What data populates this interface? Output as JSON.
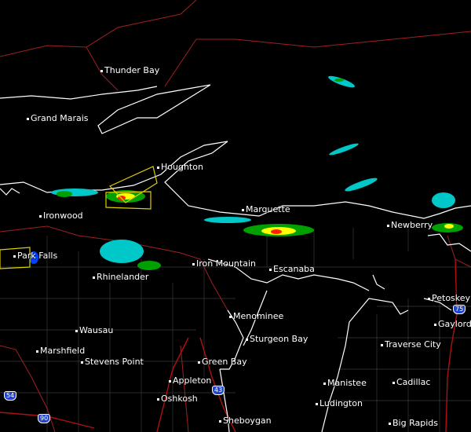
{
  "map": {
    "background": "#000000",
    "colors": {
      "land_boundary": "#a02020",
      "county_line": "#444444",
      "shoreline": "#ffffff",
      "interstate": "#b01010",
      "warning_polygon": "#e0d000",
      "radar_light": "#00c8c8",
      "radar_medium": "#00a000",
      "radar_strong": "#ffff00",
      "radar_severe": "#ff2000"
    },
    "cities": [
      {
        "name": "Thunder Bay"
      },
      {
        "name": "Grand Marais"
      },
      {
        "name": "Houghton"
      },
      {
        "name": "Ironwood"
      },
      {
        "name": "Marquette"
      },
      {
        "name": "Newberry"
      },
      {
        "name": "Park Falls"
      },
      {
        "name": "Rhinelander"
      },
      {
        "name": "Iron Mountain"
      },
      {
        "name": "Escanaba"
      },
      {
        "name": "Petoskey"
      },
      {
        "name": "Gaylord"
      },
      {
        "name": "Menominee"
      },
      {
        "name": "Wausau"
      },
      {
        "name": "Sturgeon Bay"
      },
      {
        "name": "Traverse City"
      },
      {
        "name": "Marshfield"
      },
      {
        "name": "Stevens Point"
      },
      {
        "name": "Green Bay"
      },
      {
        "name": "Appleton"
      },
      {
        "name": "Oshkosh"
      },
      {
        "name": "Manistee"
      },
      {
        "name": "Cadillac"
      },
      {
        "name": "Ludington"
      },
      {
        "name": "Sheboygan"
      },
      {
        "name": "Big Rapids"
      }
    ],
    "highways": [
      {
        "label": "75"
      },
      {
        "label": "43"
      },
      {
        "label": "54"
      },
      {
        "label": "90"
      }
    ]
  }
}
